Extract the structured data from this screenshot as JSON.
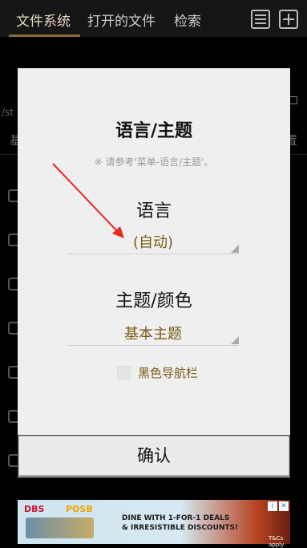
{
  "tabs": [
    {
      "label": "文件系统"
    },
    {
      "label": "打开的文件"
    },
    {
      "label": "检索"
    }
  ],
  "background": {
    "path_text": "/st",
    "row_label_left": "基",
    "row_label_right": "置"
  },
  "dialog": {
    "title": "语言/主题",
    "hint": "※ 请参考'菜单-语言/主题'。",
    "language_label": "语言",
    "language_value": "(自动)",
    "theme_label": "主题/颜色",
    "theme_value": "基本主题",
    "black_navbar_label": "黑色导航栏",
    "black_navbar_checked": false,
    "confirm_label": "确认"
  },
  "ad": {
    "brand_1": "DBS",
    "brand_2": "POSB",
    "line_1": "DINE WITH 1-FOR-1 DEALS",
    "line_2": "& IRRESISTIBLE DISCOUNTS!",
    "tnc": "T&Cs apply",
    "info_icon": "i",
    "close_icon": "✕"
  },
  "colors": {
    "accent": "#8a6a3a",
    "select_text": "#7a5a16",
    "annotation_arrow": "#e8281f"
  }
}
